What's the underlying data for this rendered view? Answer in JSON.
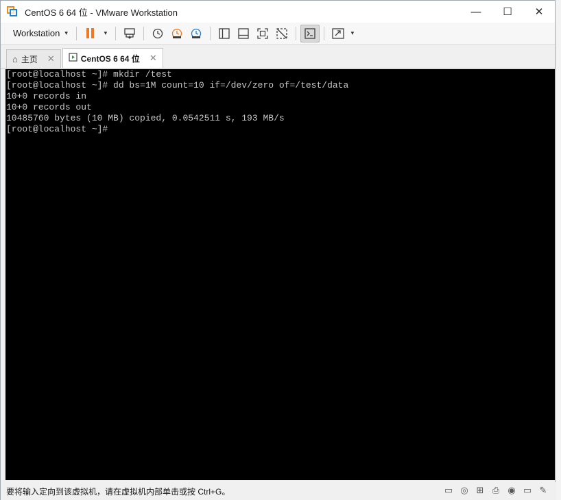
{
  "window": {
    "title": "CentOS 6 64 位 - VMware Workstation",
    "controls": {
      "minimize": "—",
      "maximize": "☐",
      "close": "✕"
    }
  },
  "toolbar": {
    "workstation_label": "Workstation",
    "caret": "▾"
  },
  "tabs": [
    {
      "label": "主页",
      "icon": "home-icon",
      "close": "✕"
    },
    {
      "label": "CentOS 6 64 位",
      "icon": "vm-icon",
      "close": "✕"
    }
  ],
  "console": {
    "lines": [
      "[root@localhost ~]# mkdir /test",
      "[root@localhost ~]# dd bs=1M count=10 if=/dev/zero of=/test/data",
      "10+0 records in",
      "10+0 records out",
      "10485760 bytes (10 MB) copied, 0.0542511 s, 193 MB/s",
      "[root@localhost ~]#"
    ]
  },
  "status": {
    "text": "要将输入定向到该虚拟机，请在虚拟机内部单击或按 Ctrl+G。"
  }
}
